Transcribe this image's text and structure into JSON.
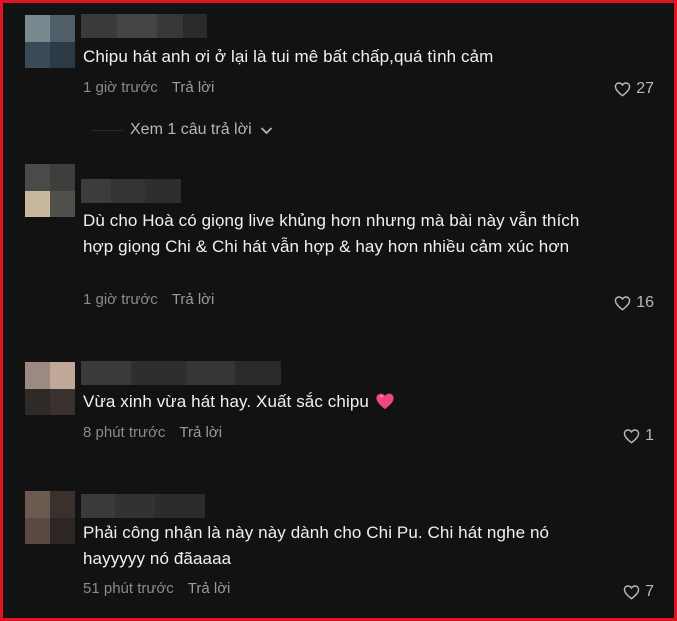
{
  "comments": [
    {
      "text": "Chipu hát anh ơi ở lại là tui mê bất chấp,quá tình cảm",
      "time": "1 giờ trước",
      "reply_label": "Trả lời",
      "likes": "27",
      "view_replies": "Xem 1 câu trả lời"
    },
    {
      "text": "Dù cho Hoà có giọng live khủng hơn nhưng mà bài này vẫn thích hợp giọng Chi & Chi hát vẫn hợp & hay hơn nhiều cảm xúc hơn",
      "time": "1 giờ trước",
      "reply_label": "Trả lời",
      "likes": "16"
    },
    {
      "text": "Vừa xinh vừa hát hay. Xuất sắc chipu",
      "emoji": "pink-heart-emoji",
      "time": "8 phút trước",
      "reply_label": "Trả lời",
      "likes": "1"
    },
    {
      "text": "Phải công nhận là này này dành cho Chi Pu. Chi hát nghe nó hayyyyy nó đãaaaa",
      "time": "51 phút trước",
      "reply_label": "Trả lời",
      "likes": "7"
    }
  ],
  "icons": {
    "like": "heart-outline-icon",
    "expand": "chevron-down-icon"
  },
  "colors": {
    "background": "#121212",
    "border": "#e0141e",
    "text": "#f1f1f2",
    "muted": "#8a8b91",
    "heart_emoji": "#f0487a"
  }
}
